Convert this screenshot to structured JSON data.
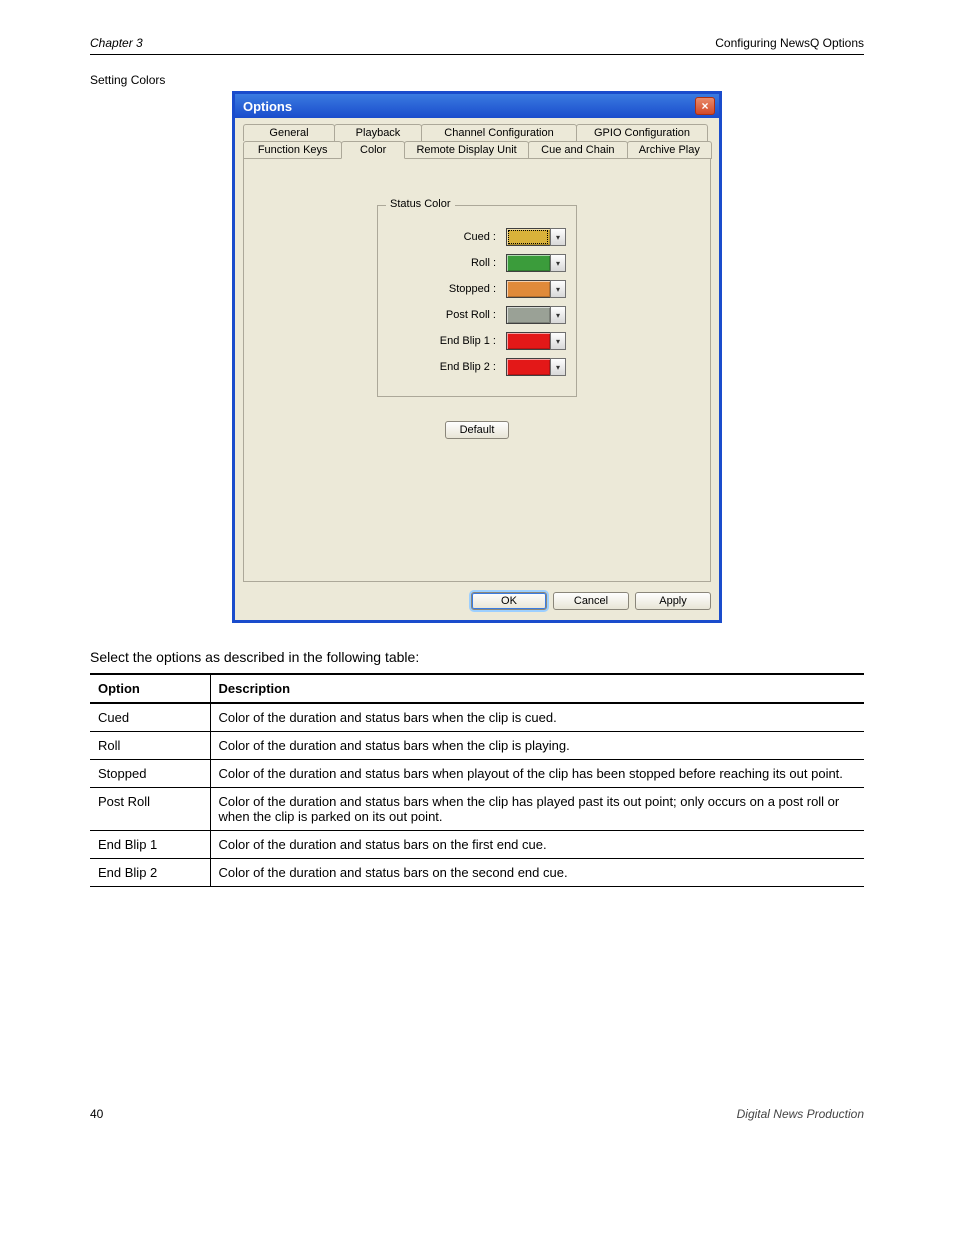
{
  "header": {
    "chapter": "Chapter 3",
    "section": "Configuring NewsQ Options"
  },
  "caption": "Setting Colors",
  "dialog": {
    "title": "Options",
    "tabs_row1": [
      "General",
      "Playback",
      "Channel Configuration",
      "GPIO Configuration"
    ],
    "tabs_row2": [
      "Function Keys",
      "Color",
      "Remote Display Unit",
      "Cue and Chain",
      "Archive Play"
    ],
    "group_legend": "Status Color",
    "rows": [
      {
        "label": "Cued :",
        "color": "#d9b23a",
        "selected": true
      },
      {
        "label": "Roll :",
        "color": "#3b9c3b",
        "selected": false
      },
      {
        "label": "Stopped :",
        "color": "#e08a3a",
        "selected": false
      },
      {
        "label": "Post Roll :",
        "color": "#9aa196",
        "selected": false
      },
      {
        "label": "End Blip 1 :",
        "color": "#e31818",
        "selected": false
      },
      {
        "label": "End Blip 2 :",
        "color": "#e31818",
        "selected": false
      }
    ],
    "default_btn": "Default",
    "ok": "OK",
    "cancel": "Cancel",
    "apply": "Apply"
  },
  "desc": "Select the options as described in the following table:",
  "table": {
    "head": [
      "Option",
      "Description"
    ],
    "rows": [
      [
        "Cued",
        "Color of the duration and status bars when the clip is cued."
      ],
      [
        "Roll",
        "Color of the duration and status bars when the clip is playing."
      ],
      [
        "Stopped",
        "Color of the duration and status bars when playout of the clip has been stopped before reaching its out point."
      ],
      [
        "Post Roll",
        "Color of the duration and status bars when the clip has played past its out point; only occurs on a post roll or when the clip is parked on its out point."
      ],
      [
        "End Blip 1",
        "Color of the duration and status bars on the first end cue."
      ],
      [
        "End Blip 2",
        "Color of the duration and status bars on the second end cue."
      ]
    ]
  },
  "footer": {
    "page": "40",
    "manual": "Digital News Production"
  }
}
